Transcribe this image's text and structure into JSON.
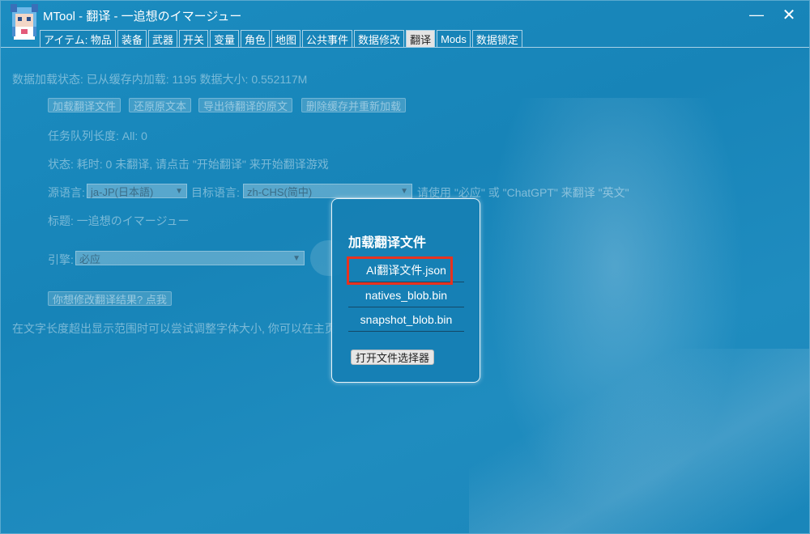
{
  "window": {
    "title": "MTool - 翻译 - 一追想のイマージュー",
    "minimize_glyph": "—",
    "close_glyph": "✕"
  },
  "tabs": [
    {
      "label": "アイテム: 物品",
      "active": false
    },
    {
      "label": "装备",
      "active": false
    },
    {
      "label": "武器",
      "active": false
    },
    {
      "label": "开关",
      "active": false
    },
    {
      "label": "变量",
      "active": false
    },
    {
      "label": "角色",
      "active": false
    },
    {
      "label": "地图",
      "active": false
    },
    {
      "label": "公共事件",
      "active": false
    },
    {
      "label": "数据修改",
      "active": false
    },
    {
      "label": "翻译",
      "active": true
    },
    {
      "label": "Mods",
      "active": false
    },
    {
      "label": "数据锁定",
      "active": false
    }
  ],
  "main": {
    "data_status": "数据加载状态: 已从缓存内加载: 1195 数据大小: 0.552117M",
    "buttons": {
      "load": "加载翻译文件",
      "restore": "还原原文本",
      "export": "导出待翻译的原文",
      "clear_cache": "删除缓存并重新加载"
    },
    "queue_length": "任务队列长度: All: 0",
    "status": "状态: 耗时: 0 未翻译, 请点击 \"开始翻译\" 来开始翻译游戏",
    "source_lang_label": "源语言:",
    "source_lang_value": "ja-JP(日本語)",
    "target_lang_label": "目标语言:",
    "target_lang_value": "zh-CHS(简中)",
    "lang_hint": "请使用 \"必应\" 或 \"ChatGPT\" 来翻译 \"英文\"",
    "title_label": "标题: 一追想のイマージュー",
    "engine_label": "引擎:",
    "engine_value": "必应",
    "modify_button": "你想修改翻译结果? 点我",
    "font_hint": "在文字长度超出显示范围时可以尝试调整字体大小, 你可以在主页"
  },
  "dialog": {
    "title": "加载翻译文件",
    "files": [
      "AI翻译文件.json",
      "natives_blob.bin",
      "snapshot_blob.bin"
    ],
    "open_button": "打开文件选择器"
  },
  "colors": {
    "background": "#1784b8",
    "highlight": "#e8321f",
    "active_tab": "#e4e4e4"
  }
}
